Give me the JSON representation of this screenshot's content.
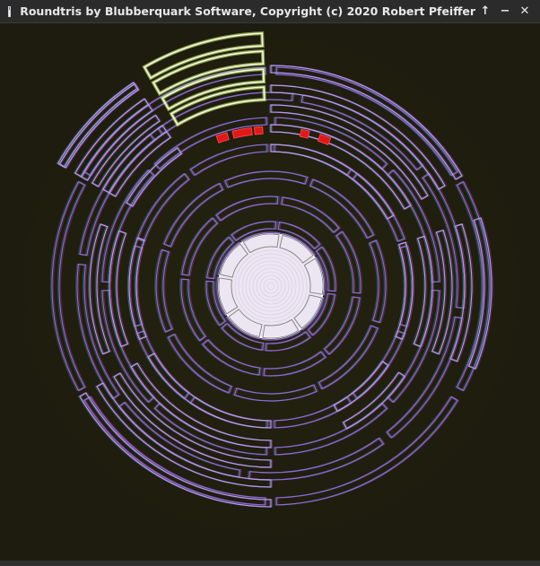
{
  "window": {
    "title": "Roundtris by Blubberquark Software, Copyright (c) 2020 Robert Pfeiffer",
    "controls": {
      "keep_above": "↑",
      "minimize": "−",
      "close": "✕"
    }
  },
  "game": {
    "colors": {
      "background": "#1e1c0e",
      "vignette": "#25230f",
      "ring_outline": "#8a6ad8",
      "ring_outline_hi": "#b89af0",
      "active_piece": "#f5f5f5",
      "active_glow": "#c8f050",
      "core_fill": "#ece6f2",
      "danger_piece": "#e01818"
    },
    "rings": [
      {
        "id": "core-ring",
        "inner": 44,
        "outer": 60,
        "segments": 8,
        "offset": 11
      },
      {
        "id": "ring-1",
        "inner": 64,
        "outer": 72,
        "segments": 8,
        "offset": 6
      },
      {
        "id": "ring-2",
        "inner": 92,
        "outer": 100,
        "segments": 8,
        "offset": 6
      },
      {
        "id": "ring-3",
        "inner": 120,
        "outer": 128,
        "segments": 8,
        "offset": 20
      },
      {
        "id": "ring-4",
        "inner": 150,
        "outer": 158,
        "segments": 10,
        "offset": 0
      },
      {
        "id": "ring-5",
        "inner": 180,
        "outer": 188,
        "segments": 8,
        "offset": 0
      },
      {
        "id": "ring-6",
        "inner": 208,
        "outer": 216,
        "segments": 8,
        "offset": 8
      },
      {
        "id": "ring-7",
        "inner": 236,
        "outer": 244,
        "segments": 6,
        "offset": 0
      }
    ],
    "arms": [
      {
        "id": "arm-upper-right",
        "from": 0,
        "to": 60,
        "inner": 150,
        "outer": 240
      },
      {
        "id": "arm-right",
        "from": 72,
        "to": 112,
        "inner": 150,
        "outer": 240
      },
      {
        "id": "arm-lower-right",
        "from": 124,
        "to": 152,
        "inner": 150,
        "outer": 190
      },
      {
        "id": "arm-bottom",
        "from": 180,
        "to": 240,
        "inner": 150,
        "outer": 240
      },
      {
        "id": "arm-left",
        "from": 248,
        "to": 290,
        "inner": 150,
        "outer": 210
      },
      {
        "id": "arm-upper-left",
        "from": 300,
        "to": 326,
        "inner": 178,
        "outer": 288
      }
    ],
    "active_piece": {
      "from": 330,
      "to": 358,
      "inner": 208,
      "outer": 288,
      "bands": 4
    },
    "danger_blocks": [
      {
        "from": 340,
        "to": 344
      },
      {
        "from": 346,
        "to": 353
      },
      {
        "from": 354,
        "to": 357
      },
      {
        "from": 11,
        "to": 14
      },
      {
        "from": 18,
        "to": 22
      }
    ],
    "danger_radius": [
      170,
      178
    ]
  }
}
